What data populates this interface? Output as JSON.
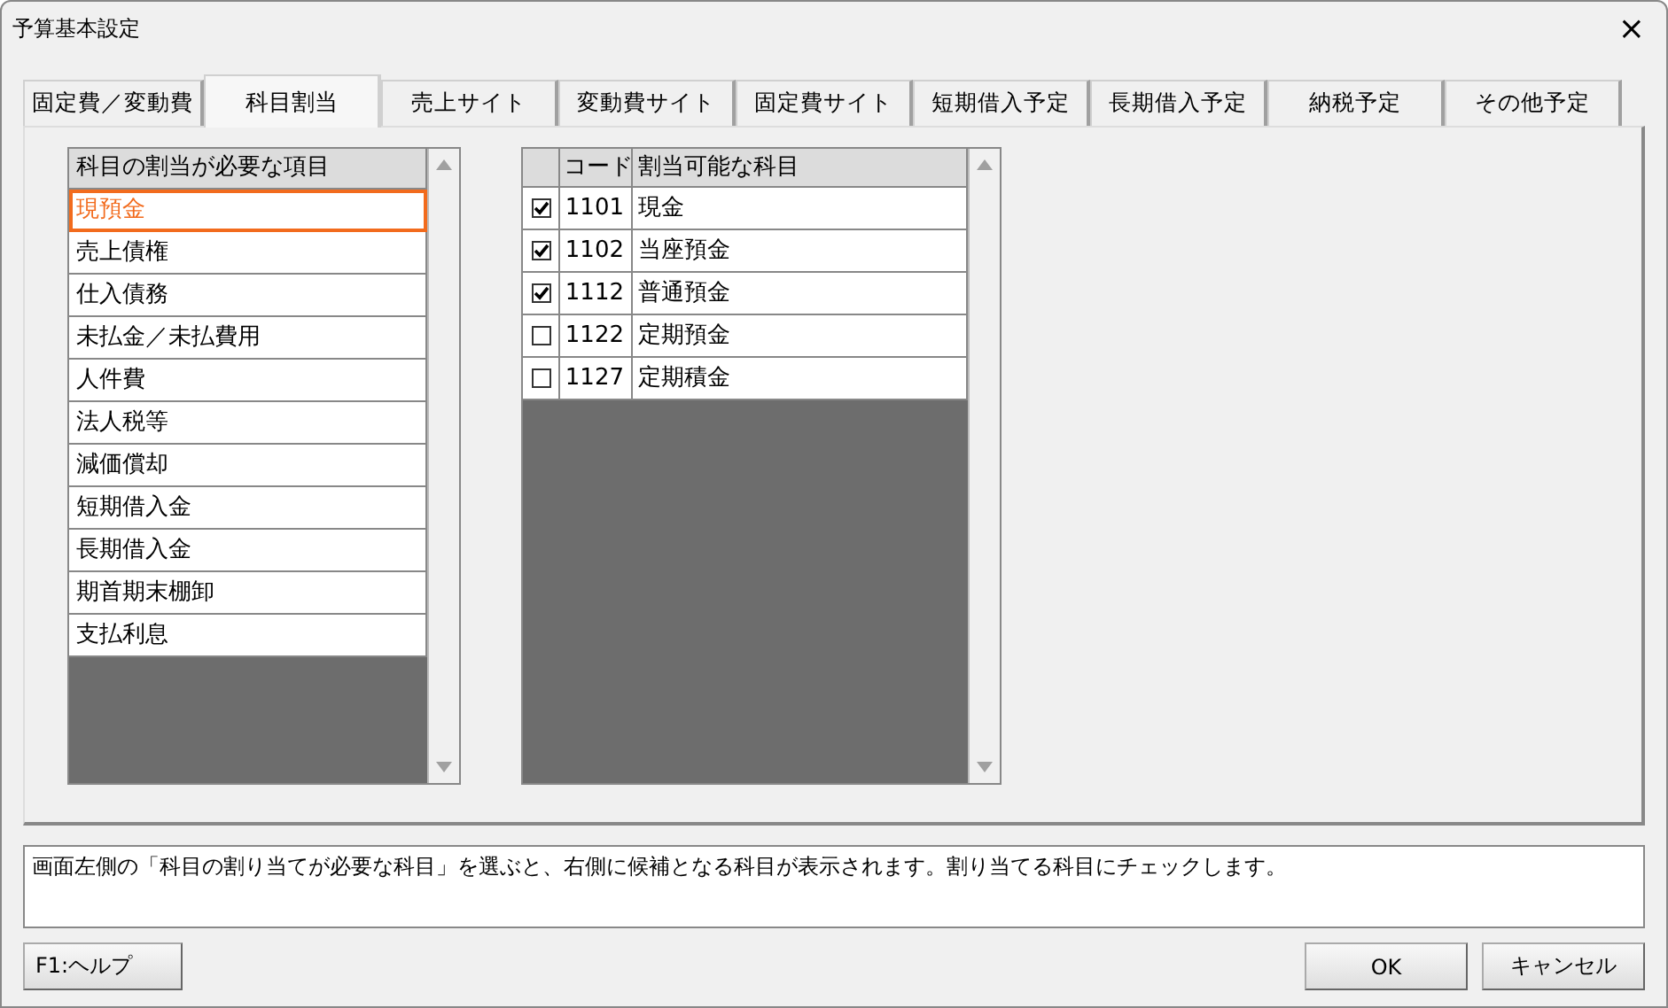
{
  "window": {
    "title": "予算基本設定",
    "close": "×"
  },
  "tabs": [
    {
      "label": "固定費／変動費",
      "selected": false
    },
    {
      "label": "科目割当",
      "selected": true
    },
    {
      "label": "売上サイト",
      "selected": false
    },
    {
      "label": "変動費サイト",
      "selected": false
    },
    {
      "label": "固定費サイト",
      "selected": false
    },
    {
      "label": "短期借入予定",
      "selected": false
    },
    {
      "label": "長期借入予定",
      "selected": false
    },
    {
      "label": "納税予定",
      "selected": false
    },
    {
      "label": "その他予定",
      "selected": false
    }
  ],
  "items_list": {
    "header": "科目の割当が必要な項目",
    "items": [
      {
        "label": "現預金",
        "selected": true
      },
      {
        "label": "売上債権",
        "selected": false
      },
      {
        "label": "仕入債務",
        "selected": false
      },
      {
        "label": "未払金／未払費用",
        "selected": false
      },
      {
        "label": "人件費",
        "selected": false
      },
      {
        "label": "法人税等",
        "selected": false
      },
      {
        "label": "減価償却",
        "selected": false
      },
      {
        "label": "短期借入金",
        "selected": false
      },
      {
        "label": "長期借入金",
        "selected": false
      },
      {
        "label": "期首期末棚卸",
        "selected": false
      },
      {
        "label": "支払利息",
        "selected": false
      }
    ]
  },
  "accounts_table": {
    "columns": [
      "コード",
      "割当可能な科目"
    ],
    "rows": [
      {
        "checked": true,
        "code": "1101",
        "name": "現金"
      },
      {
        "checked": true,
        "code": "1102",
        "name": "当座預金"
      },
      {
        "checked": true,
        "code": "1112",
        "name": "普通預金"
      },
      {
        "checked": false,
        "code": "1122",
        "name": "定期預金"
      },
      {
        "checked": false,
        "code": "1127",
        "name": "定期積金"
      }
    ]
  },
  "help_text": "画面左側の「科目の割り当てが必要な科目」を選ぶと、右側に候補となる科目が表示されます。割り当てる科目にチェックします。",
  "buttons": {
    "help": "F1:ヘルプ",
    "ok": "OK",
    "cancel": "キャンセル"
  }
}
